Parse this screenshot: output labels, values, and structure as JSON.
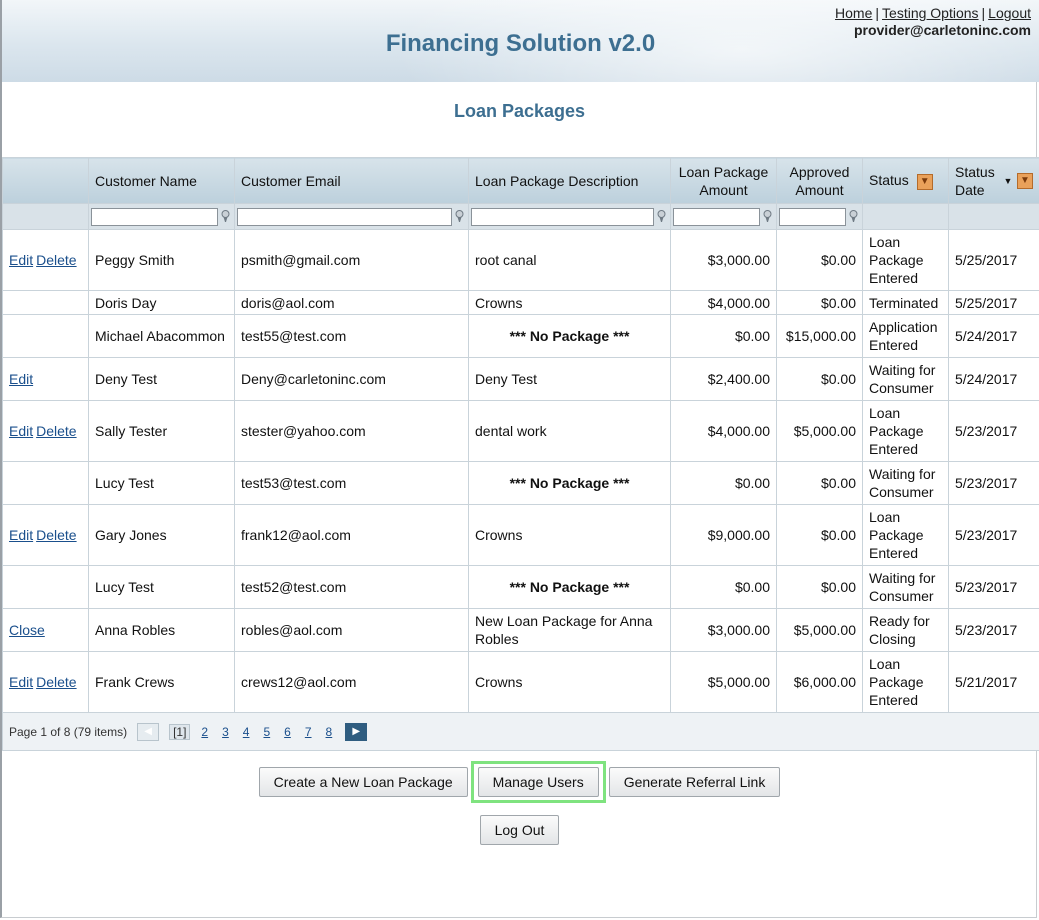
{
  "header": {
    "app_title": "Financing Solution v2.0",
    "links": {
      "home": "Home",
      "testing_options": "Testing Options",
      "logout": "Logout",
      "separator": "|"
    },
    "user_email": "provider@carletoninc.com"
  },
  "page_title": "Loan Packages",
  "table": {
    "columns": {
      "actions": "",
      "customer_name": "Customer Name",
      "customer_email": "Customer Email",
      "description": "Loan Package Description",
      "amount": "Loan Package Amount",
      "approved": "Approved Amount",
      "status": "Status",
      "status_date": "Status Date"
    },
    "rows": [
      {
        "edit": "Edit",
        "delete": "Delete",
        "close": "",
        "name": "Peggy Smith",
        "email": "psmith@gmail.com",
        "desc": "root canal",
        "no_package": false,
        "amount": "$3,000.00",
        "approved": "$0.00",
        "status": "Loan Package Entered",
        "date": "5/25/2017"
      },
      {
        "edit": "",
        "delete": "",
        "close": "",
        "name": "Doris Day",
        "email": "doris@aol.com",
        "desc": "Crowns",
        "no_package": false,
        "amount": "$4,000.00",
        "approved": "$0.00",
        "status": "Terminated",
        "date": "5/25/2017"
      },
      {
        "edit": "",
        "delete": "",
        "close": "",
        "name": "Michael Abacommon",
        "email": "test55@test.com",
        "desc": "*** No Package ***",
        "no_package": true,
        "amount": "$0.00",
        "approved": "$15,000.00",
        "status": "Application Entered",
        "date": "5/24/2017"
      },
      {
        "edit": "Edit",
        "delete": "",
        "close": "",
        "name": "Deny Test",
        "email": "Deny@carletoninc.com",
        "desc": "Deny Test",
        "no_package": false,
        "amount": "$2,400.00",
        "approved": "$0.00",
        "status": "Waiting for Consumer",
        "date": "5/24/2017"
      },
      {
        "edit": "Edit",
        "delete": "Delete",
        "close": "",
        "name": "Sally Tester",
        "email": "stester@yahoo.com",
        "desc": "dental work",
        "no_package": false,
        "amount": "$4,000.00",
        "approved": "$5,000.00",
        "status": "Loan Package Entered",
        "date": "5/23/2017"
      },
      {
        "edit": "",
        "delete": "",
        "close": "",
        "name": "Lucy Test",
        "email": "test53@test.com",
        "desc": "*** No Package ***",
        "no_package": true,
        "amount": "$0.00",
        "approved": "$0.00",
        "status": "Waiting for Consumer",
        "date": "5/23/2017"
      },
      {
        "edit": "Edit",
        "delete": "Delete",
        "close": "",
        "name": "Gary Jones",
        "email": "frank12@aol.com",
        "desc": "Crowns",
        "no_package": false,
        "amount": "$9,000.00",
        "approved": "$0.00",
        "status": "Loan Package Entered",
        "date": "5/23/2017"
      },
      {
        "edit": "",
        "delete": "",
        "close": "",
        "name": "Lucy Test",
        "email": "test52@test.com",
        "desc": "*** No Package ***",
        "no_package": true,
        "amount": "$0.00",
        "approved": "$0.00",
        "status": "Waiting for Consumer",
        "date": "5/23/2017"
      },
      {
        "edit": "",
        "delete": "",
        "close": "Close",
        "name": "Anna Robles",
        "email": "robles@aol.com",
        "desc": "New Loan Package for Anna Robles",
        "no_package": false,
        "amount": "$3,000.00",
        "approved": "$5,000.00",
        "status": "Ready for Closing",
        "date": "5/23/2017"
      },
      {
        "edit": "Edit",
        "delete": "Delete",
        "close": "",
        "name": "Frank Crews",
        "email": "crews12@aol.com",
        "desc": "Crowns",
        "no_package": false,
        "amount": "$5,000.00",
        "approved": "$6,000.00",
        "status": "Loan Package Entered",
        "date": "5/21/2017"
      }
    ],
    "row_heights": [],
    "pager": {
      "summary": "Page 1 of 8 (79 items)",
      "current": "[1]",
      "pages": [
        "2",
        "3",
        "4",
        "5",
        "6",
        "7",
        "8"
      ]
    }
  },
  "buttons": {
    "create": "Create a New Loan Package",
    "manage_users": "Manage Users",
    "referral": "Generate Referral Link",
    "log_out": "Log Out"
  },
  "colors": {
    "title": "#3d6f91",
    "link": "#1a4f8c",
    "highlight": "#7fe37f",
    "sort_icon": "#e9a15a"
  },
  "icons": {
    "filter": "funnel-filter-icon",
    "sort": "sort-arrow-icon",
    "prev": "chevron-left-icon",
    "next": "chevron-right-icon"
  }
}
